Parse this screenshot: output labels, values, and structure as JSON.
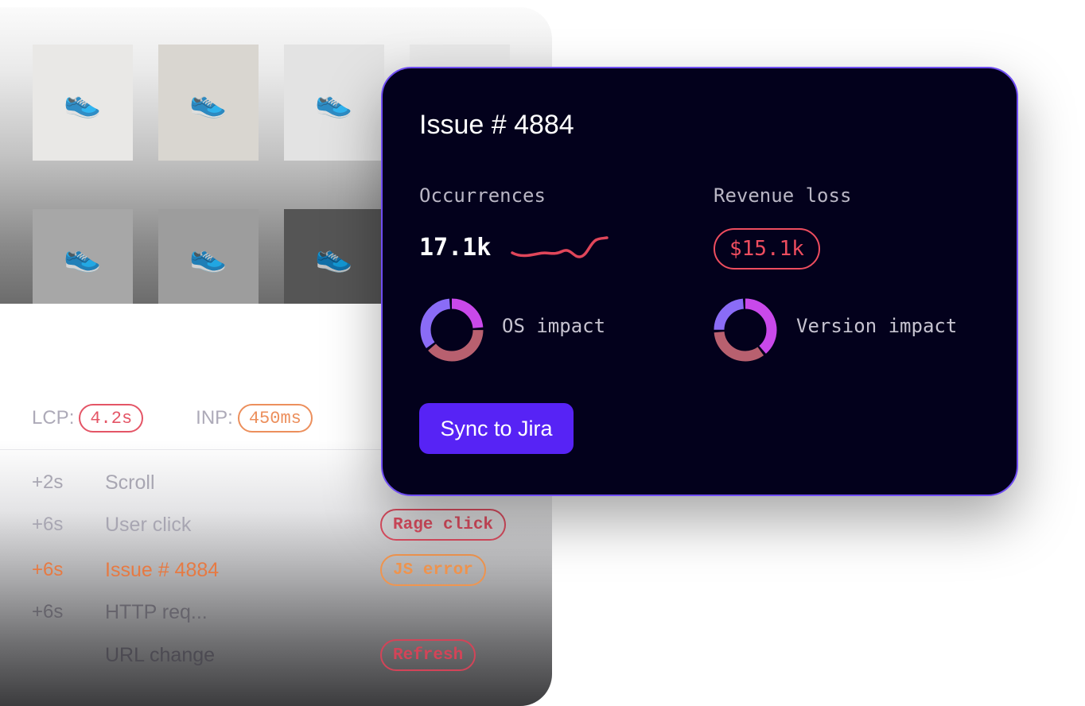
{
  "gallery": {
    "thumbnails": [
      {
        "icon": "sneaker-pink-icon",
        "glyph": "👟",
        "bg": "#e9e8e6"
      },
      {
        "icon": "sneaker-yellow-icon",
        "glyph": "👟",
        "bg": "#d9d6d0"
      },
      {
        "icon": "sneaker-white-icon",
        "glyph": "👟",
        "bg": "#e3e3e3"
      },
      {
        "icon": "sneaker-gray-icon",
        "glyph": "👟",
        "bg": "#e8e8e8"
      },
      {
        "icon": "sneaker-green-icon",
        "glyph": "👟",
        "bg": "#a7a7a7"
      },
      {
        "icon": "sneaker-red-icon",
        "glyph": "👟",
        "bg": "#9d9d9d"
      },
      {
        "icon": "sneaker-black-icon",
        "glyph": "👟",
        "bg": "#555555"
      }
    ]
  },
  "metrics": {
    "lcp": {
      "label": "LCP:",
      "value": "4.2s"
    },
    "inp": {
      "label": "INP:",
      "value": "450ms"
    }
  },
  "events": [
    {
      "time": "+2s",
      "name": "Scroll",
      "tag": "",
      "color": "#a8a6b2",
      "tag_color": ""
    },
    {
      "time": "+6s",
      "name": "User click",
      "tag": "Rage click",
      "color": "#a8a6b2",
      "tag_color": "#dc4d60"
    },
    {
      "time": "+6s",
      "name": "Issue # 4884",
      "tag": "JS error",
      "color": "#e67a43",
      "tag_color": "#f0954f"
    },
    {
      "time": "+6s",
      "name": "HTTP req...",
      "tag": "",
      "color": "#66646c",
      "tag_color": ""
    },
    {
      "time": "",
      "name": "URL change",
      "tag": "Refresh",
      "color": "#4c4a52",
      "tag_color": "#d34458"
    }
  ],
  "issue_card": {
    "title": "Issue # 4884",
    "occurrences_label": "Occurrences",
    "occurrences_value": "17.1k",
    "revenue_label": "Revenue loss",
    "revenue_value": "$15.1k",
    "os_impact_label": "OS impact",
    "version_impact_label": "Version impact",
    "sync_button": "Sync to Jira",
    "os_impact_segments": [
      {
        "share": 0.25,
        "color": "#c949ea"
      },
      {
        "share": 0.4,
        "color": "#b8606f"
      },
      {
        "share": 0.35,
        "color": "#8a6cf6"
      }
    ],
    "version_impact_segments": [
      {
        "share": 0.4,
        "color": "#c949ea"
      },
      {
        "share": 0.35,
        "color": "#b8606f"
      },
      {
        "share": 0.25,
        "color": "#8a6cf6"
      }
    ]
  },
  "colors": {
    "card_bg": "#03011c",
    "card_border": "#6f4df2",
    "accent_button": "#5723f5",
    "sparkline": "#e0465a",
    "revenue": "#ee4d5f"
  }
}
